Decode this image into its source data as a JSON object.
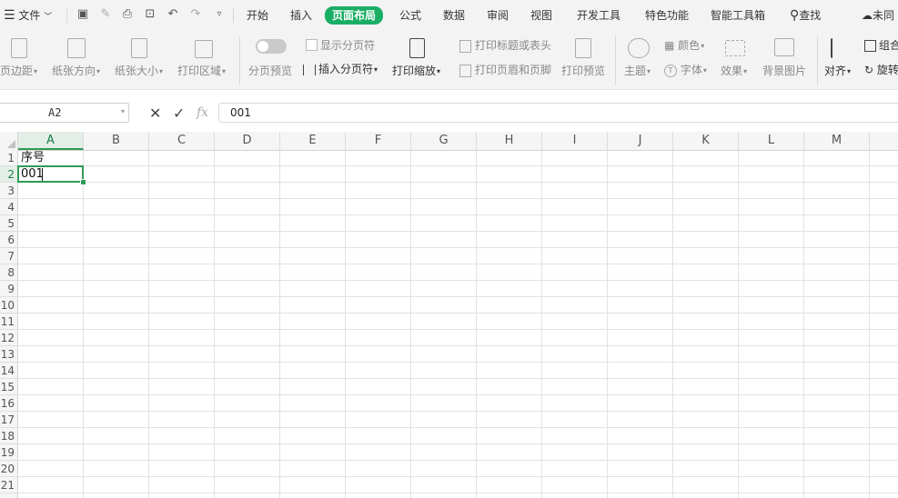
{
  "menubar": {
    "file_label": "文件",
    "tabs": [
      {
        "id": "start",
        "label": "开始"
      },
      {
        "id": "insert",
        "label": "插入"
      },
      {
        "id": "page-layout",
        "label": "页面布局",
        "active": true
      },
      {
        "id": "formulas",
        "label": "公式"
      },
      {
        "id": "data",
        "label": "数据"
      },
      {
        "id": "review",
        "label": "审阅"
      },
      {
        "id": "view",
        "label": "视图"
      },
      {
        "id": "developer",
        "label": "开发工具"
      },
      {
        "id": "features",
        "label": "特色功能"
      },
      {
        "id": "smart-toolbox",
        "label": "智能工具箱"
      }
    ],
    "search_label": "查找",
    "sync_label": "未同"
  },
  "ribbon": {
    "margins": "页边距",
    "orientation": "纸张方向",
    "size": "纸张大小",
    "print_area": "打印区域",
    "page_break_preview": "分页预览",
    "show_page_breaks": "显示分页符",
    "insert_page_break": "插入分页符",
    "print_scaling": "打印缩放",
    "print_titles": "打印标题或表头",
    "print_header_footer": "打印页眉和页脚",
    "print_preview": "打印预览",
    "theme": "主题",
    "colors": "颜色",
    "fonts": "字体",
    "effects": "效果",
    "background": "背景图片",
    "align": "对齐",
    "group": "组合",
    "rotate": "旋转"
  },
  "formula_bar": {
    "name_box": "A2",
    "fx_label": "fx",
    "value": "001"
  },
  "sheet": {
    "columns": [
      "A",
      "B",
      "C",
      "D",
      "E",
      "F",
      "G",
      "H",
      "I",
      "J",
      "K",
      "L",
      "M"
    ],
    "rows": [
      "1",
      "2",
      "3",
      "4",
      "5",
      "6",
      "7",
      "8",
      "9",
      "10",
      "11",
      "12",
      "13",
      "14",
      "15",
      "16",
      "17",
      "18",
      "19",
      "20",
      "21"
    ],
    "selected_column": "A",
    "selected_row": "2",
    "cells": {
      "A1": "序号",
      "A2": "001"
    }
  }
}
